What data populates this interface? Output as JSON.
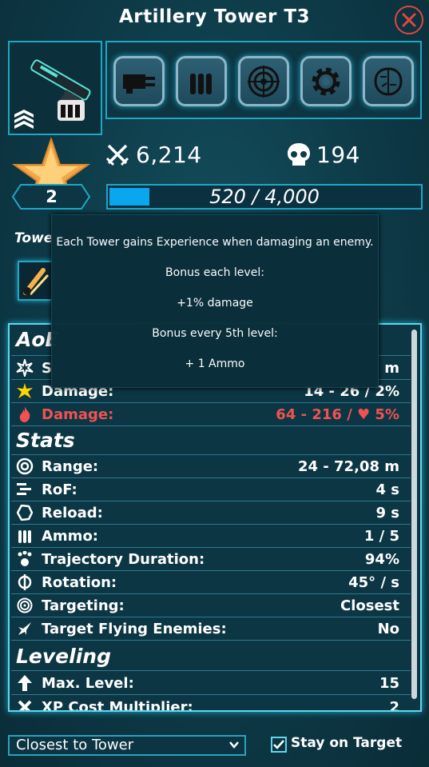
{
  "title": "Artillery Tower T3",
  "tower": {
    "level": "2",
    "damage_dealt": "6,214",
    "kills": "194",
    "xp_text": "520 / 4,000",
    "xp_fraction": 0.13
  },
  "upgrade_icons": [
    "gatling-icon",
    "ammo-icon",
    "radar-icon",
    "gear-icon",
    "brain-icon"
  ],
  "towers_label": "Towe",
  "tooltip": {
    "line1": "Each Tower gains Experience when damaging an enemy.",
    "line2": "Bonus each level:",
    "line3": "+1% damage",
    "line4": "Bonus every 5th level:",
    "line5": "+ 1 Ammo"
  },
  "aoe": {
    "title": "AoE",
    "row1": {
      "label": "S",
      "value": "m"
    },
    "row2": {
      "label": "Damage:",
      "value": "14 - 26 / 2%"
    },
    "row3": {
      "label": "Damage:",
      "value": "64 - 216 / ♥ 5%"
    }
  },
  "stats": {
    "title": "Stats",
    "rows": [
      {
        "label": "Range:",
        "value": "24 - 72,08 m"
      },
      {
        "label": "RoF:",
        "value": "4 s"
      },
      {
        "label": "Reload:",
        "value": "9 s"
      },
      {
        "label": "Ammo:",
        "value": "1 / 5"
      },
      {
        "label": "Trajectory Duration:",
        "value": "94%"
      },
      {
        "label": "Rotation:",
        "value": "45° / s"
      },
      {
        "label": "Targeting:",
        "value": "Closest"
      },
      {
        "label": "Target Flying Enemies:",
        "value": "No"
      }
    ]
  },
  "leveling": {
    "title": "Leveling",
    "rows": [
      {
        "label": "Max. Level:",
        "value": "15"
      },
      {
        "label": "XP Cost Multiplier:",
        "value": "2"
      }
    ]
  },
  "footer": {
    "targeting_select": "Closest to Tower",
    "stay_on_target": "Stay on Target",
    "stay_checked": true
  },
  "colors": {
    "accent": "#1fa7c5",
    "xp_fill": "#0aa6ee",
    "damage_red": "#f05252",
    "close_red": "#e2463e"
  }
}
